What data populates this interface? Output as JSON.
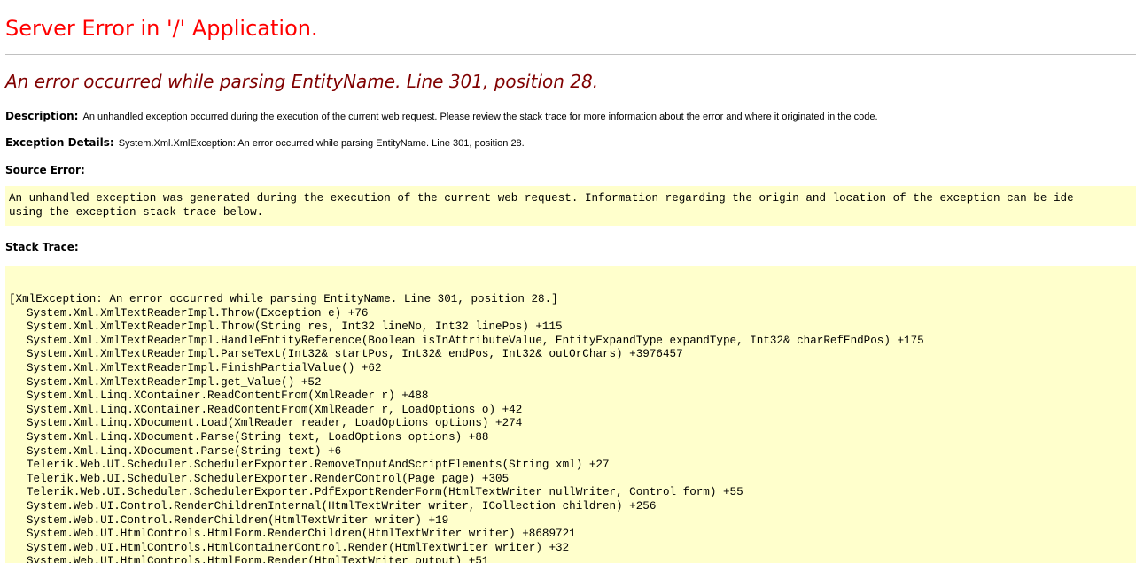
{
  "page": {
    "title": "Server Error in '/' Application.",
    "error_message": "An error occurred while parsing EntityName. Line 301, position 28.",
    "description": {
      "label": "Description:",
      "text": "An unhandled exception occurred during the execution of the current web request. Please review the stack trace for more information about the error and where it originated in the code."
    },
    "exception_details": {
      "label": "Exception Details:",
      "text": "System.Xml.XmlException: An error occurred while parsing EntityName. Line 301, position 28."
    },
    "source_error": {
      "label": "Source Error:",
      "lines": [
        "An unhandled exception was generated during the execution of the current web request. Information regarding the origin and location of the exception can be ide",
        "using the exception stack trace below."
      ]
    },
    "stack_trace": {
      "label": "Stack Trace:",
      "exception_header": "[XmlException: An error occurred while parsing EntityName. Line 301, position 28.]",
      "frames": [
        "System.Xml.XmlTextReaderImpl.Throw(Exception e) +76",
        "System.Xml.XmlTextReaderImpl.Throw(String res, Int32 lineNo, Int32 linePos) +115",
        "System.Xml.XmlTextReaderImpl.HandleEntityReference(Boolean isInAttributeValue, EntityExpandType expandType, Int32& charRefEndPos) +175",
        "System.Xml.XmlTextReaderImpl.ParseText(Int32& startPos, Int32& endPos, Int32& outOrChars) +3976457",
        "System.Xml.XmlTextReaderImpl.FinishPartialValue() +62",
        "System.Xml.XmlTextReaderImpl.get_Value() +52",
        "System.Xml.Linq.XContainer.ReadContentFrom(XmlReader r) +488",
        "System.Xml.Linq.XContainer.ReadContentFrom(XmlReader r, LoadOptions o) +42",
        "System.Xml.Linq.XDocument.Load(XmlReader reader, LoadOptions options) +274",
        "System.Xml.Linq.XDocument.Parse(String text, LoadOptions options) +88",
        "System.Xml.Linq.XDocument.Parse(String text) +6",
        "Telerik.Web.UI.Scheduler.SchedulerExporter.RemoveInputAndScriptElements(String xml) +27",
        "Telerik.Web.UI.Scheduler.SchedulerExporter.RenderControl(Page page) +305",
        "Telerik.Web.UI.Scheduler.SchedulerExporter.PdfExportRenderForm(HtmlTextWriter nullWriter, Control form) +55",
        "System.Web.UI.Control.RenderChildrenInternal(HtmlTextWriter writer, ICollection children) +256",
        "System.Web.UI.Control.RenderChildren(HtmlTextWriter writer) +19",
        "System.Web.UI.HtmlControls.HtmlForm.RenderChildren(HtmlTextWriter writer) +8689721",
        "System.Web.UI.HtmlControls.HtmlContainerControl.Render(HtmlTextWriter writer) +32",
        "System.Web.UI.HtmlControls.HtmlForm.Render(HtmlTextWriter output) +51"
      ]
    }
  }
}
